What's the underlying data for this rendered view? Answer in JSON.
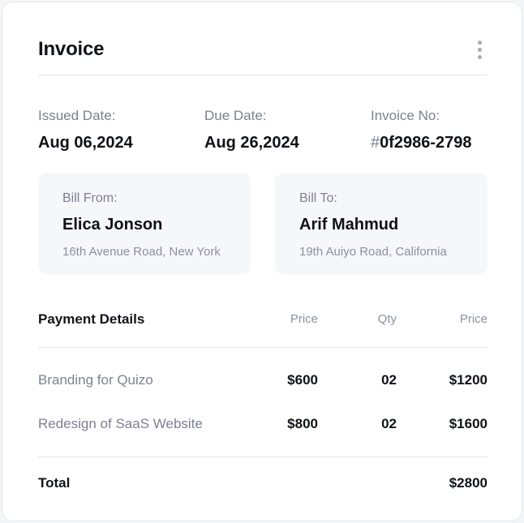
{
  "invoice": {
    "title": "Invoice",
    "menu_icon": "more-vertical-icon",
    "issued": {
      "label": "Issued Date:",
      "value": "Aug 06,2024"
    },
    "due": {
      "label": "Due Date:",
      "value": "Aug 26,2024"
    },
    "number": {
      "label": "Invoice No:",
      "hash": "#",
      "value": "0f2986-2798"
    },
    "bill_from": {
      "label": "Bill From:",
      "name": "Elica Jonson",
      "address": "16th Avenue Road, New York"
    },
    "bill_to": {
      "label": "Bill To:",
      "name": "Arif Mahmud",
      "address": "19th Auiyo Road, California"
    },
    "table": {
      "headers": {
        "description": "Payment Details",
        "price": "Price",
        "qty": "Qty",
        "total": "Price"
      },
      "rows": [
        {
          "description": "Branding for Quizo",
          "price": "$600",
          "qty": "02",
          "total": "$1200"
        },
        {
          "description": "Redesign of SaaS Website",
          "price": "$800",
          "qty": "02",
          "total": "$1600"
        }
      ],
      "total": {
        "label": "Total",
        "value": "$2800"
      }
    },
    "colors": {
      "text": "#0f1216",
      "muted": "#7b8190",
      "panel": "#f5f7fa",
      "border": "#e6e8ec"
    }
  }
}
